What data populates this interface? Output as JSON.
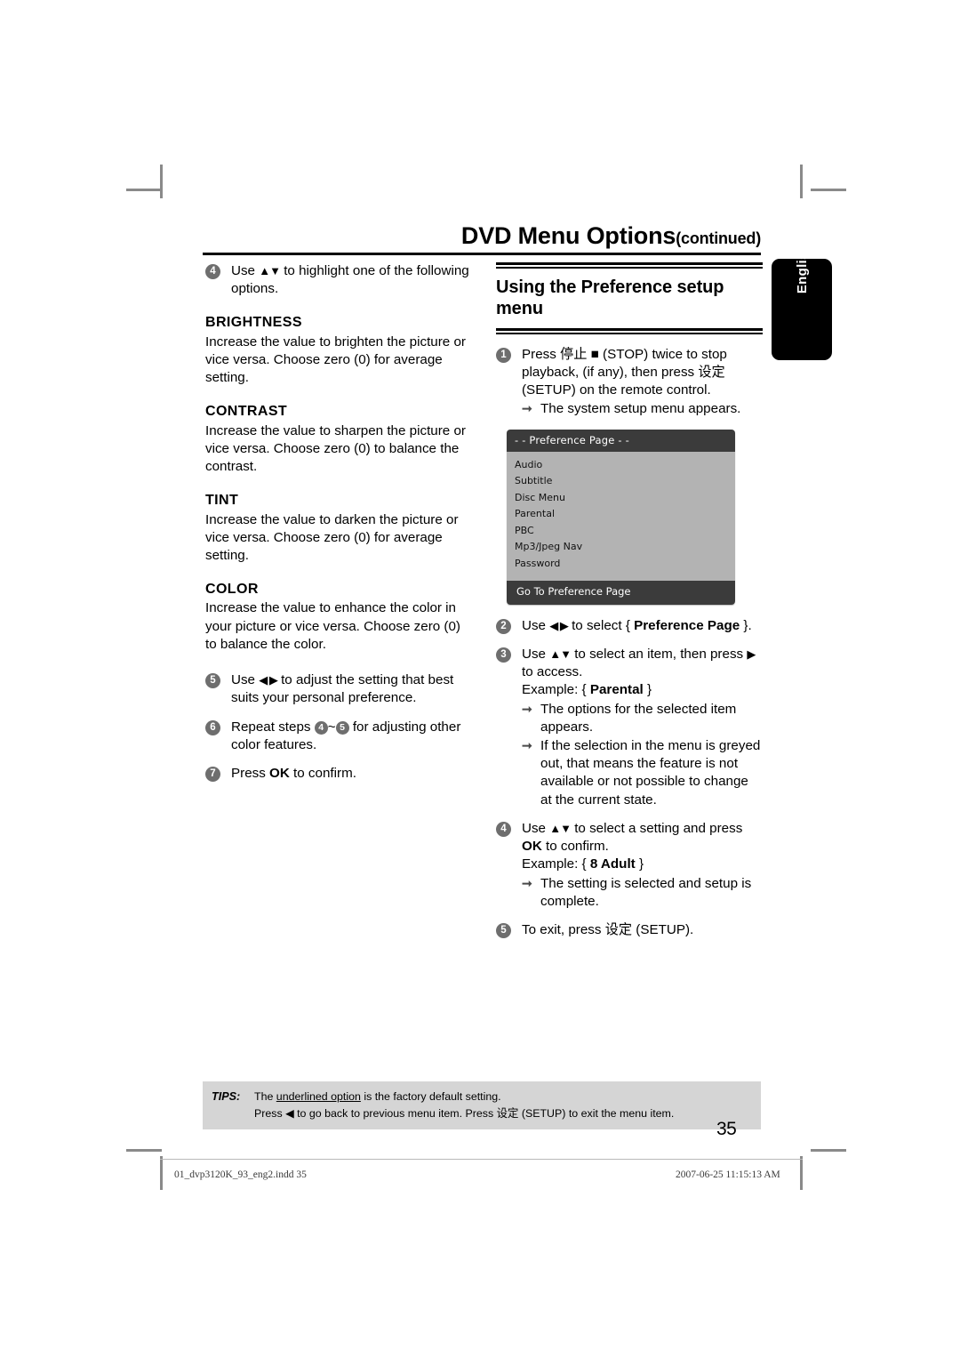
{
  "header": {
    "title_main": "DVD Menu Options",
    "title_sub": "(continued)"
  },
  "language_tab": {
    "label": "English"
  },
  "left_column": {
    "step4": {
      "number": "4",
      "text_before": "Use ",
      "arrows": "▲▼",
      "text_after": " to highlight one of the following options."
    },
    "definitions": [
      {
        "term": "BRIGHTNESS",
        "body": "Increase the value to brighten the picture or vice versa. Choose zero (0) for average setting."
      },
      {
        "term": "CONTRAST",
        "body": "Increase the value to sharpen the picture or vice versa.  Choose zero (0) to balance the contrast."
      },
      {
        "term": "TINT",
        "body": "Increase the value to darken the picture or vice versa.  Choose zero (0) for average setting."
      },
      {
        "term": "COLOR",
        "body": "Increase the value to enhance the color in your picture or vice versa. Choose zero (0) to balance the color."
      }
    ],
    "step5": {
      "number": "5",
      "text_before": "Use ",
      "arrows": "◀ ▶",
      "text_after": " to adjust the setting that best suits your personal preference."
    },
    "step6": {
      "number": "6",
      "text_before": "Repeat steps ",
      "ref_from": "4",
      "tilde": "~",
      "ref_to": "5",
      "text_after": " for adjusting other color features."
    },
    "step7": {
      "number": "7",
      "text_before": "Press ",
      "key": "OK",
      "text_after": " to confirm."
    }
  },
  "right_column": {
    "section_title": "Using the Preference setup menu",
    "step1": {
      "number": "1",
      "text": "Press 停止 ■ (STOP) twice to stop playback, (if any), then press 设定 (SETUP) on the remote control.",
      "result": "The system setup menu appears."
    },
    "osd_menu": {
      "title": "- -   Preference Page   - -",
      "items": [
        "Audio",
        "Subtitle",
        "Disc Menu",
        "Parental",
        "PBC",
        "Mp3/Jpeg Nav",
        "Password"
      ],
      "footer": "Go To Preference Page"
    },
    "step2": {
      "number": "2",
      "text_before": "Use ",
      "arrows": "◀ ▶",
      "text_mid": " to select { ",
      "bold": "Preference Page",
      "text_after": " }."
    },
    "step3": {
      "number": "3",
      "text_before": "Use ",
      "arrows": "▲▼",
      "text_mid": " to select an item, then press ",
      "arrow_right": "▶",
      "text_after": " to access.",
      "example_label": "Example: { ",
      "example_bold": "Parental",
      "example_after": " }",
      "results": [
        "The options for the selected item appears.",
        "If the selection in the menu is greyed out, that means the feature is not available or not possible to change at the current state."
      ]
    },
    "step4": {
      "number": "4",
      "text_before": "Use ",
      "arrows": "▲▼",
      "text_mid": " to select a setting and press ",
      "key": "OK",
      "text_after": " to confirm.",
      "example_label": "Example: { ",
      "example_bold": "8 Adult",
      "example_after": " }",
      "result": "The setting is selected and setup is complete."
    },
    "step5": {
      "number": "5",
      "text": "To exit, press 设定 (SETUP)."
    }
  },
  "tips": {
    "label": "TIPS:",
    "line1_before": "The ",
    "line1_underlined": "underlined option",
    "line1_after": " is the factory default setting.",
    "line2_before": "Press ",
    "line2_arrow": "◀",
    "line2_after": " to go back to previous menu item. Press 设定 (SETUP) to exit the menu item."
  },
  "page_number": "35",
  "footer": {
    "file": "01_dvp3120K_93_eng2.indd   35",
    "date": "2007-06-25   11:15:13 AM"
  },
  "colors": {
    "step_bullet": "#6e6e6e",
    "osd_header": "#3b3b3b",
    "osd_body": "#b3b3b3",
    "tips_bg": "#d5d5d5",
    "lang_tab_bg": "#000000"
  }
}
